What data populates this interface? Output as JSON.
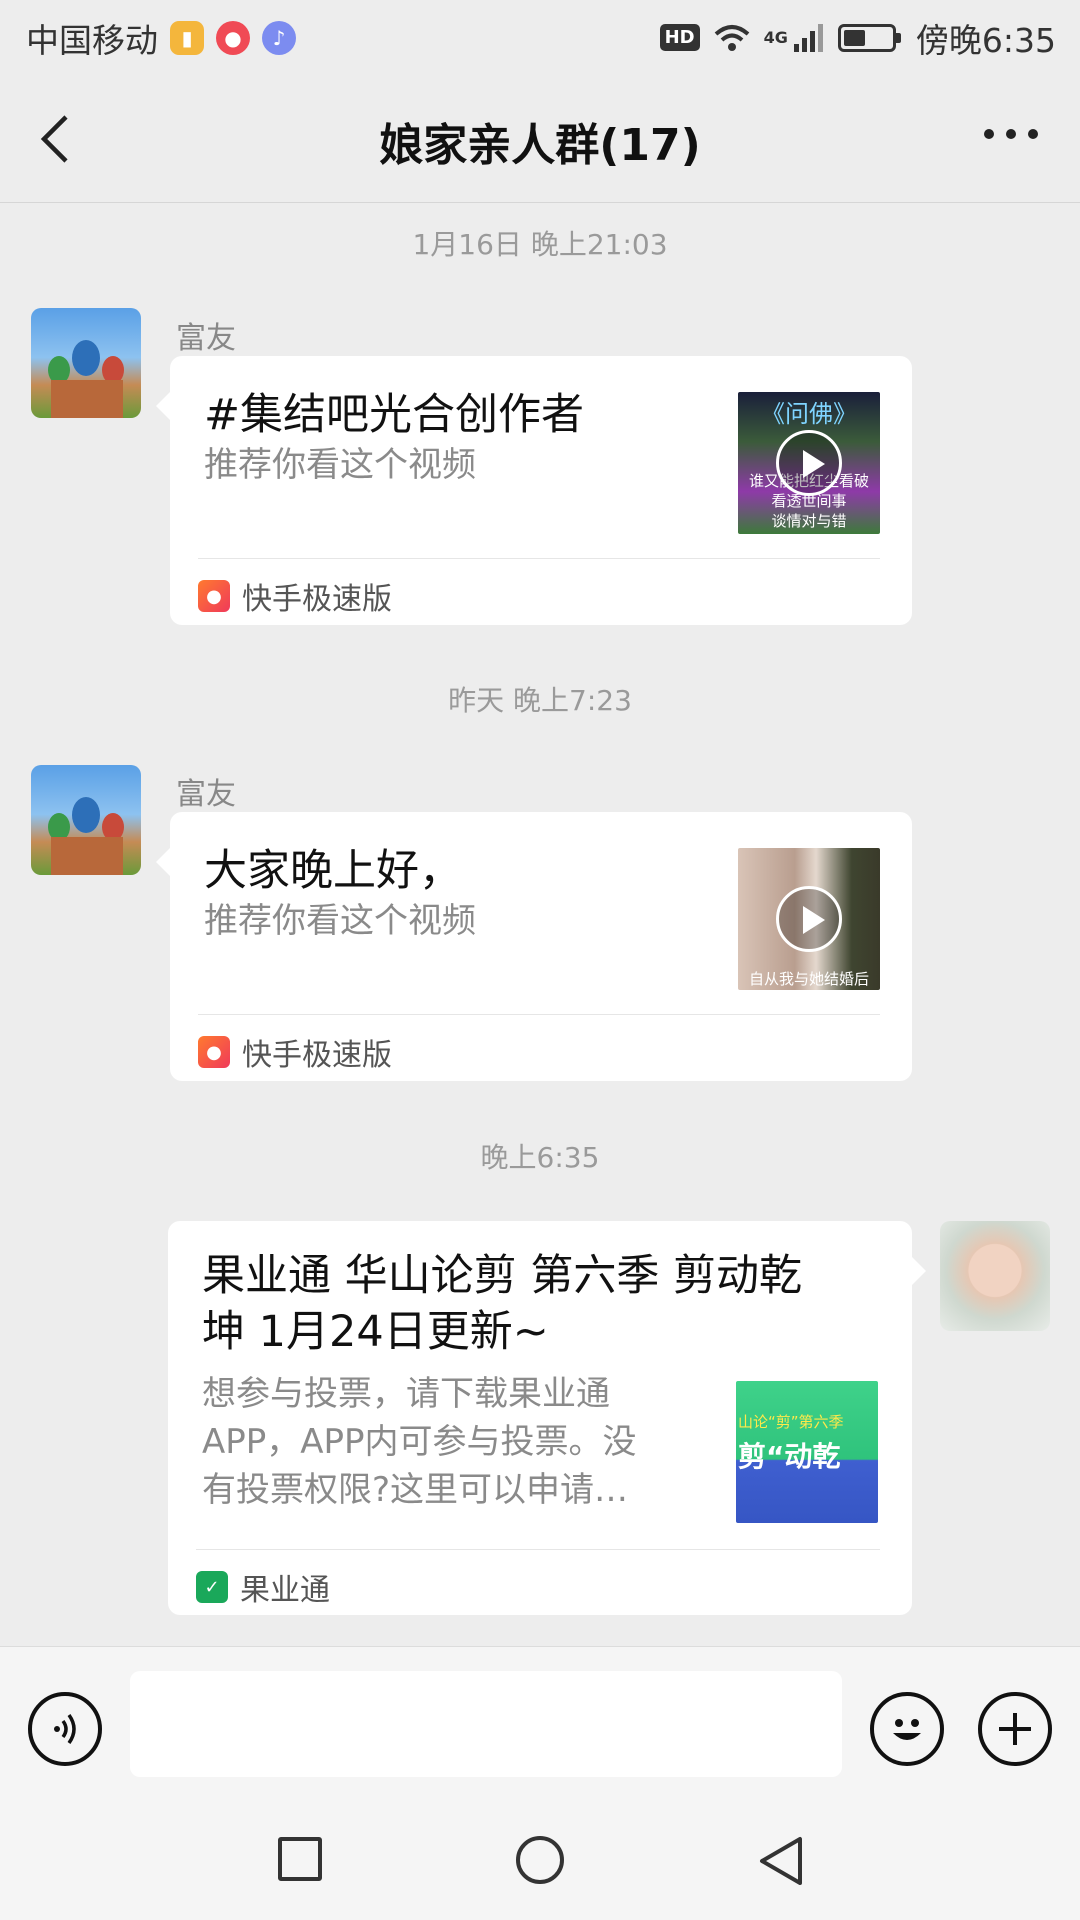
{
  "status_bar": {
    "carrier": "中国移动",
    "hd": "HD",
    "network": "4G",
    "time": "傍晚6:35"
  },
  "header": {
    "title": "娘家亲人群(17)"
  },
  "messages": [
    {
      "timestamp": "1月16日 晚上21:03",
      "sender": "富友",
      "title": "#集结吧光合创作者",
      "subtitle": "推荐你看这个视频",
      "thumb_lines": [
        "《问佛》",
        "谁又能把红尘看破",
        "看透世间事",
        "谈情对与错"
      ],
      "source": "快手极速版"
    },
    {
      "timestamp": "昨天 晚上7:23",
      "sender": "富友",
      "title": "大家晚上好，",
      "subtitle": "推荐你看这个视频",
      "thumb_lines": [
        "自从我与她结婚后"
      ],
      "source": "快手极速版"
    },
    {
      "timestamp": "晚上6:35",
      "title_line1": "果业通 华山论剪 第六季 剪动乾",
      "title_line2": "坤 1月24日更新~",
      "desc_line1": "想参与投票，请下载果业通",
      "desc_line2": "APP，APP内可参与投票。没",
      "desc_line3": "有投票权限?这里可以申请…",
      "thumb_lines": [
        "山论“剪”第六季",
        "剪“动乾"
      ],
      "source": "果业通"
    }
  ],
  "input": {
    "placeholder": ""
  },
  "icons": {
    "back": "chevron-left-icon",
    "more": "more-dots-icon",
    "voice": "voice-icon",
    "emoji": "emoji-icon",
    "plus": "plus-icon"
  }
}
